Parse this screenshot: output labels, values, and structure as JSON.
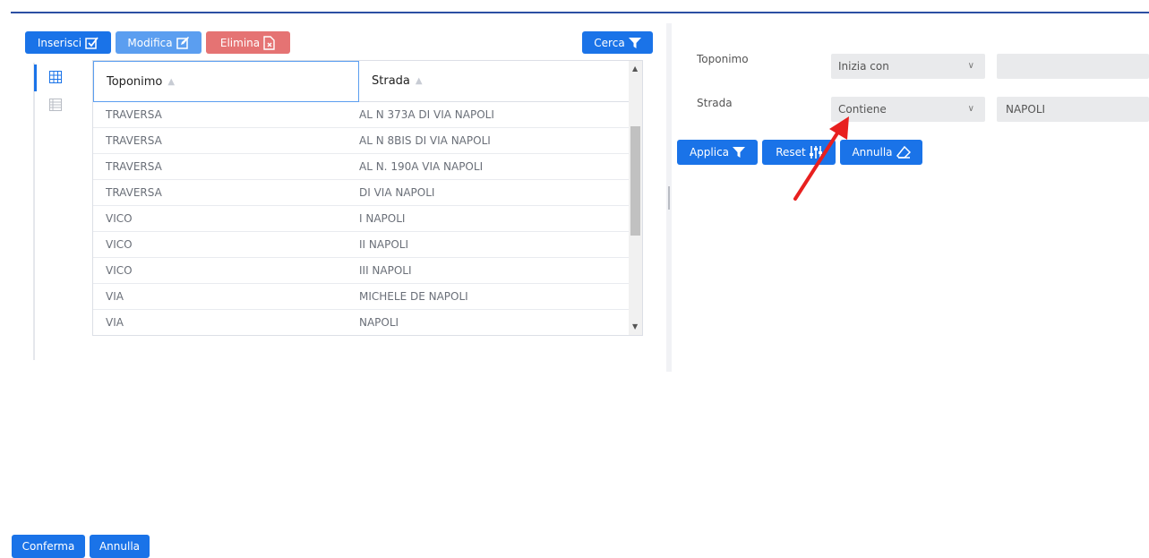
{
  "toolbar": {
    "insert_label": "Inserisci",
    "edit_label": "Modifica",
    "delete_label": "Elimina",
    "search_label": "Cerca"
  },
  "grid": {
    "columns": [
      "Toponimo",
      "Strada"
    ],
    "rows": [
      [
        "TRAVERSA",
        "AL N 373A DI VIA NAPOLI"
      ],
      [
        "TRAVERSA",
        "AL N 8BIS DI VIA NAPOLI"
      ],
      [
        "TRAVERSA",
        "AL N. 190A VIA NAPOLI"
      ],
      [
        "TRAVERSA",
        "DI VIA NAPOLI"
      ],
      [
        "VICO",
        "I NAPOLI"
      ],
      [
        "VICO",
        "II NAPOLI"
      ],
      [
        "VICO",
        "III NAPOLI"
      ],
      [
        "VIA",
        "MICHELE DE NAPOLI"
      ],
      [
        "VIA",
        "NAPOLI"
      ]
    ],
    "sort_icon": "sort-icon"
  },
  "filter": {
    "toponimo_label": "Toponimo",
    "toponimo_operator": "Inizia con",
    "toponimo_value": "",
    "strada_label": "Strada",
    "strada_operator": "Contiene",
    "strada_value": "NAPOLI",
    "apply_label": "Applica",
    "reset_label": "Reset",
    "cancel_label": "Annulla"
  },
  "footer": {
    "confirm_label": "Conferma",
    "cancel_label": "Annulla"
  },
  "colors": {
    "primary": "#1a73e8",
    "primary_light": "#5b9ef0",
    "danger": "#e57373",
    "annotation_arrow": "#e8201f"
  }
}
